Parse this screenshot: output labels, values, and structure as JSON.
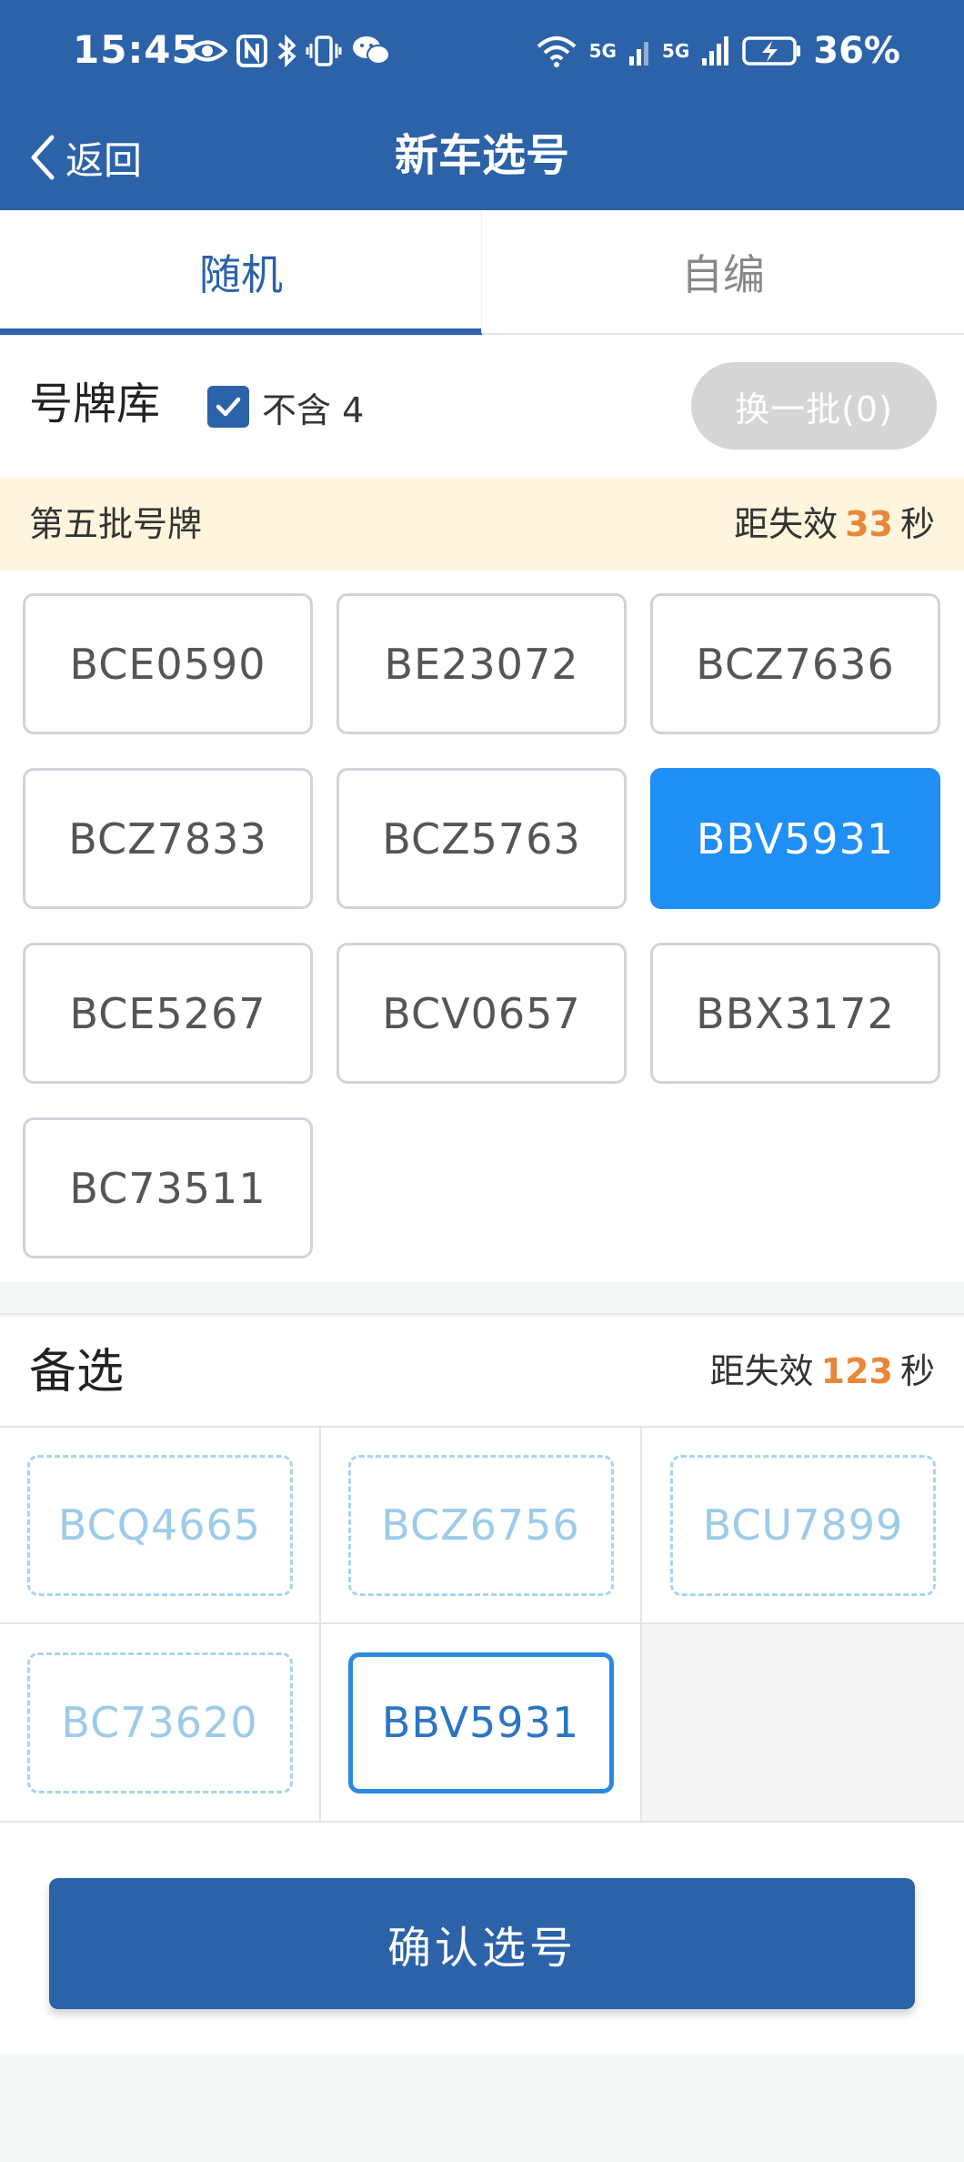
{
  "status_bar": {
    "time": "15:45",
    "battery_percent": "36%",
    "network_1": "5G",
    "network_2": "5G",
    "left_icons": [
      "eye-icon",
      "nfc-icon",
      "bluetooth-icon",
      "vibrate-icon",
      "wechat-icon"
    ],
    "right_icons": [
      "wifi-icon",
      "signal-icon",
      "signal-icon",
      "battery-charging-icon"
    ]
  },
  "nav": {
    "back_label": "返回",
    "title": "新车选号"
  },
  "tabs": [
    {
      "label": "随机",
      "active": true
    },
    {
      "label": "自编",
      "active": false
    }
  ],
  "library": {
    "title": "号牌库",
    "exclude_label": "不含 4",
    "exclude_checked": true,
    "refresh_label": "换一批(0)"
  },
  "batch": {
    "name": "第五批号牌",
    "countdown_prefix": "距失效",
    "countdown_value": "33",
    "countdown_unit": "秒"
  },
  "plates": [
    "BCE0590",
    "BE23072",
    "BCZ7636",
    "BCZ7833",
    "BCZ5763",
    "BBV5931",
    "BCE5267",
    "BCV0657",
    "BBX3172",
    "BC73511"
  ],
  "selected_plate": "BBV5931",
  "alternates": {
    "title": "备选",
    "countdown_prefix": "距失效",
    "countdown_value": "123",
    "countdown_unit": "秒",
    "items": [
      "BCQ4665",
      "BCZ6756",
      "BCU7899",
      "BC73620",
      "BBV5931"
    ],
    "chosen": "BBV5931"
  },
  "confirm_label": "确认选号",
  "colors": {
    "primary": "#2b62a8",
    "selected": "#1f8ef5",
    "countdown": "#e8873a",
    "batch_bg": "#fdf5dc"
  }
}
